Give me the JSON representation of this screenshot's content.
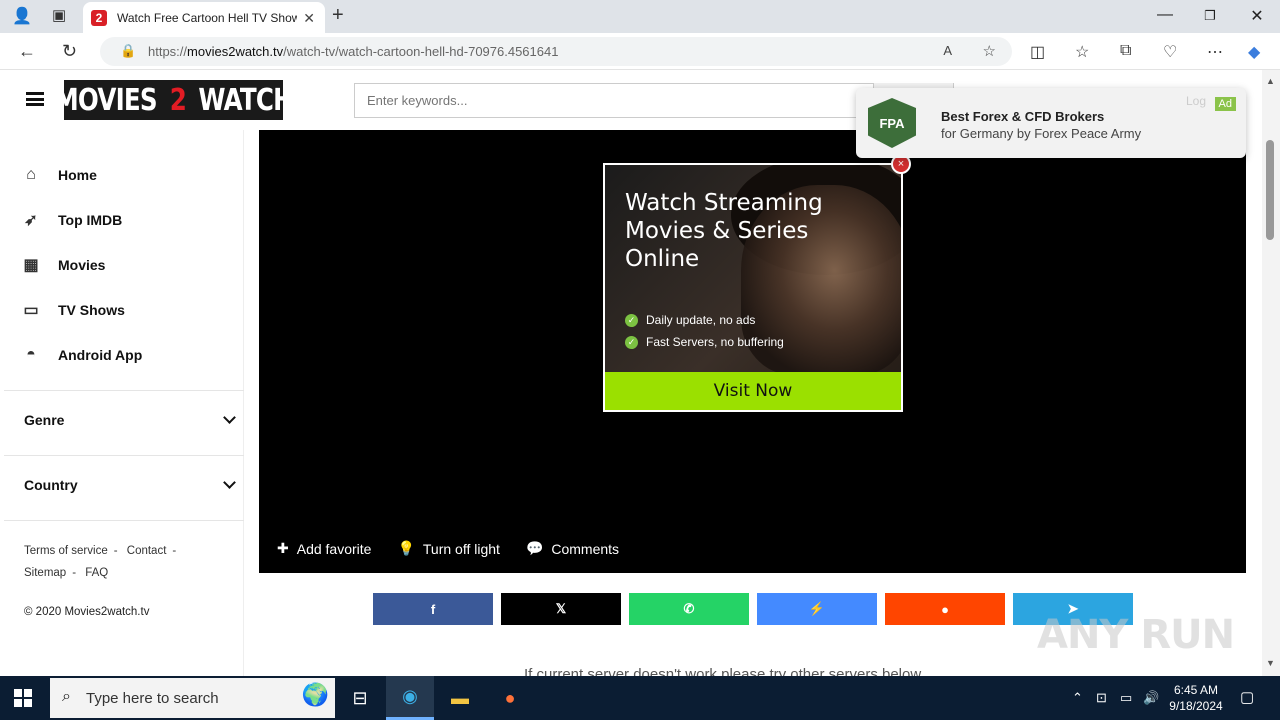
{
  "browser": {
    "tab_title": "Watch Free Cartoon Hell TV Show",
    "tab_favicon": "2",
    "url_domain": "movies2watch.tv",
    "url_prefix": "https://",
    "url_path": "/watch-tv/watch-cartoon-hell-hd-70976.4561641"
  },
  "site": {
    "logo_left": "MOVIES",
    "logo_mid": "2",
    "logo_right": "WATCH",
    "search_placeholder": "Enter keywords..."
  },
  "sidebar": {
    "items": [
      {
        "label": "Home",
        "icon": "home-icon"
      },
      {
        "label": "Top IMDB",
        "icon": "rocket-icon"
      },
      {
        "label": "Movies",
        "icon": "film-icon"
      },
      {
        "label": "TV Shows",
        "icon": "tv-icon"
      },
      {
        "label": "Android App",
        "icon": "android-icon"
      }
    ],
    "genre": "Genre",
    "country": "Country",
    "footer": {
      "terms": "Terms of service",
      "contact": "Contact",
      "sitemap": "Sitemap",
      "faq": "FAQ",
      "copyright": "© 2020 Movies2watch.tv"
    }
  },
  "ad": {
    "headline": "Watch Streaming Movies & Series Online",
    "bullet1": "Daily update, no ads",
    "bullet2": "Fast Servers, no buffering",
    "cta": "Visit Now",
    "close": "×"
  },
  "player": {
    "add_favorite": "Add favorite",
    "turn_off_light": "Turn off light",
    "comments": "Comments"
  },
  "share": [
    {
      "name": "facebook",
      "glyph": "f",
      "color": "#3b5998"
    },
    {
      "name": "x",
      "glyph": "𝕏",
      "color": "#000000"
    },
    {
      "name": "whatsapp",
      "glyph": "✆",
      "color": "#25d366"
    },
    {
      "name": "messenger",
      "glyph": "⚡",
      "color": "#448aff"
    },
    {
      "name": "reddit",
      "glyph": "●",
      "color": "#ff4500"
    },
    {
      "name": "telegram",
      "glyph": "➤",
      "color": "#2ca5e0"
    }
  ],
  "server_note": "If current server doesn't work please try other servers below.",
  "notification": {
    "logo": "FPA",
    "title": "Best Forex & CFD Brokers",
    "subtitle": "for Germany by Forex Peace Army",
    "badge": "Ad",
    "faded": "Log"
  },
  "watermark": "ANY RUN",
  "taskbar": {
    "search_placeholder": "Type here to search",
    "time": "6:45 AM",
    "date": "9/18/2024"
  }
}
